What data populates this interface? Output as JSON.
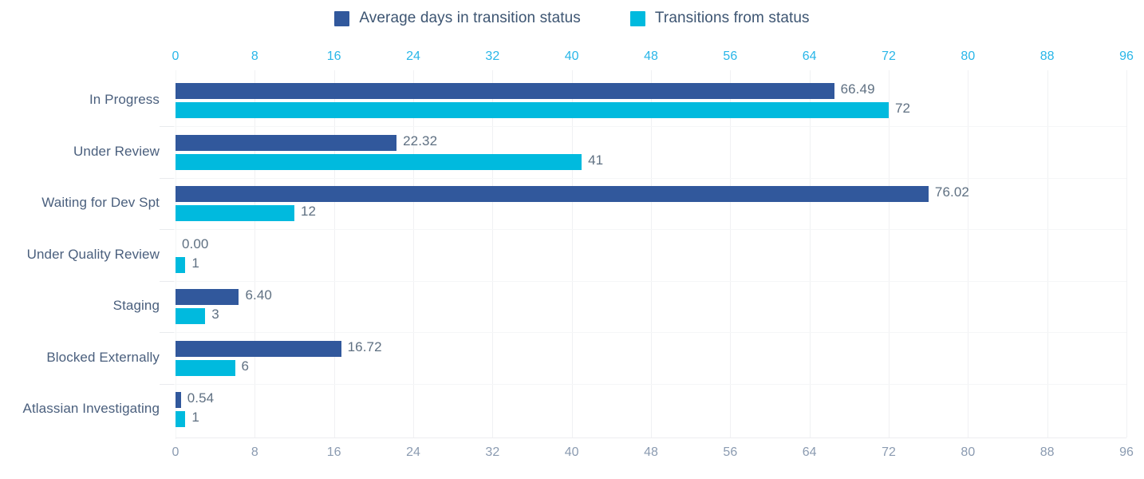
{
  "legend": {
    "items": [
      {
        "label": "Average days in transition status",
        "color": "#31589c",
        "key": "avg_days"
      },
      {
        "label": "Transitions from status",
        "color": "#00bade",
        "key": "transitions"
      }
    ]
  },
  "axis": {
    "top_ticks": [
      "0",
      "8",
      "16",
      "24",
      "32",
      "40",
      "48",
      "56",
      "64",
      "72",
      "80",
      "88",
      "96"
    ],
    "bottom_ticks": [
      "0",
      "8",
      "16",
      "24",
      "32",
      "40",
      "48",
      "56",
      "64",
      "72",
      "80",
      "88",
      "96"
    ],
    "top_tick_color": "#29b6e8",
    "bottom_tick_color": "#8b9bb1"
  },
  "chart_data": {
    "type": "bar",
    "orientation": "horizontal",
    "title": "",
    "xlabel": "",
    "ylabel": "",
    "xlim": [
      0,
      96
    ],
    "xticks": [
      0,
      8,
      16,
      24,
      32,
      40,
      48,
      56,
      64,
      72,
      80,
      88,
      96
    ],
    "grid": true,
    "legend_position": "top-center",
    "dual_axis": true,
    "categories": [
      "In Progress",
      "Under Review",
      "Waiting for Dev Spt",
      "Under Quality Review",
      "Staging",
      "Blocked Externally",
      "Atlassian Investigating"
    ],
    "series": [
      {
        "name": "Average days in transition status",
        "color": "#31589c",
        "values": [
          66.49,
          22.32,
          76.02,
          0.0,
          6.4,
          16.72,
          0.54
        ],
        "labels": [
          "66.49",
          "22.32",
          "76.02",
          "0.00",
          "6.40",
          "16.72",
          "0.54"
        ]
      },
      {
        "name": "Transitions from status",
        "color": "#00bade",
        "values": [
          72,
          41,
          12,
          1,
          3,
          6,
          1
        ],
        "labels": [
          "72",
          "41",
          "12",
          "1",
          "3",
          "6",
          "1"
        ]
      }
    ]
  }
}
